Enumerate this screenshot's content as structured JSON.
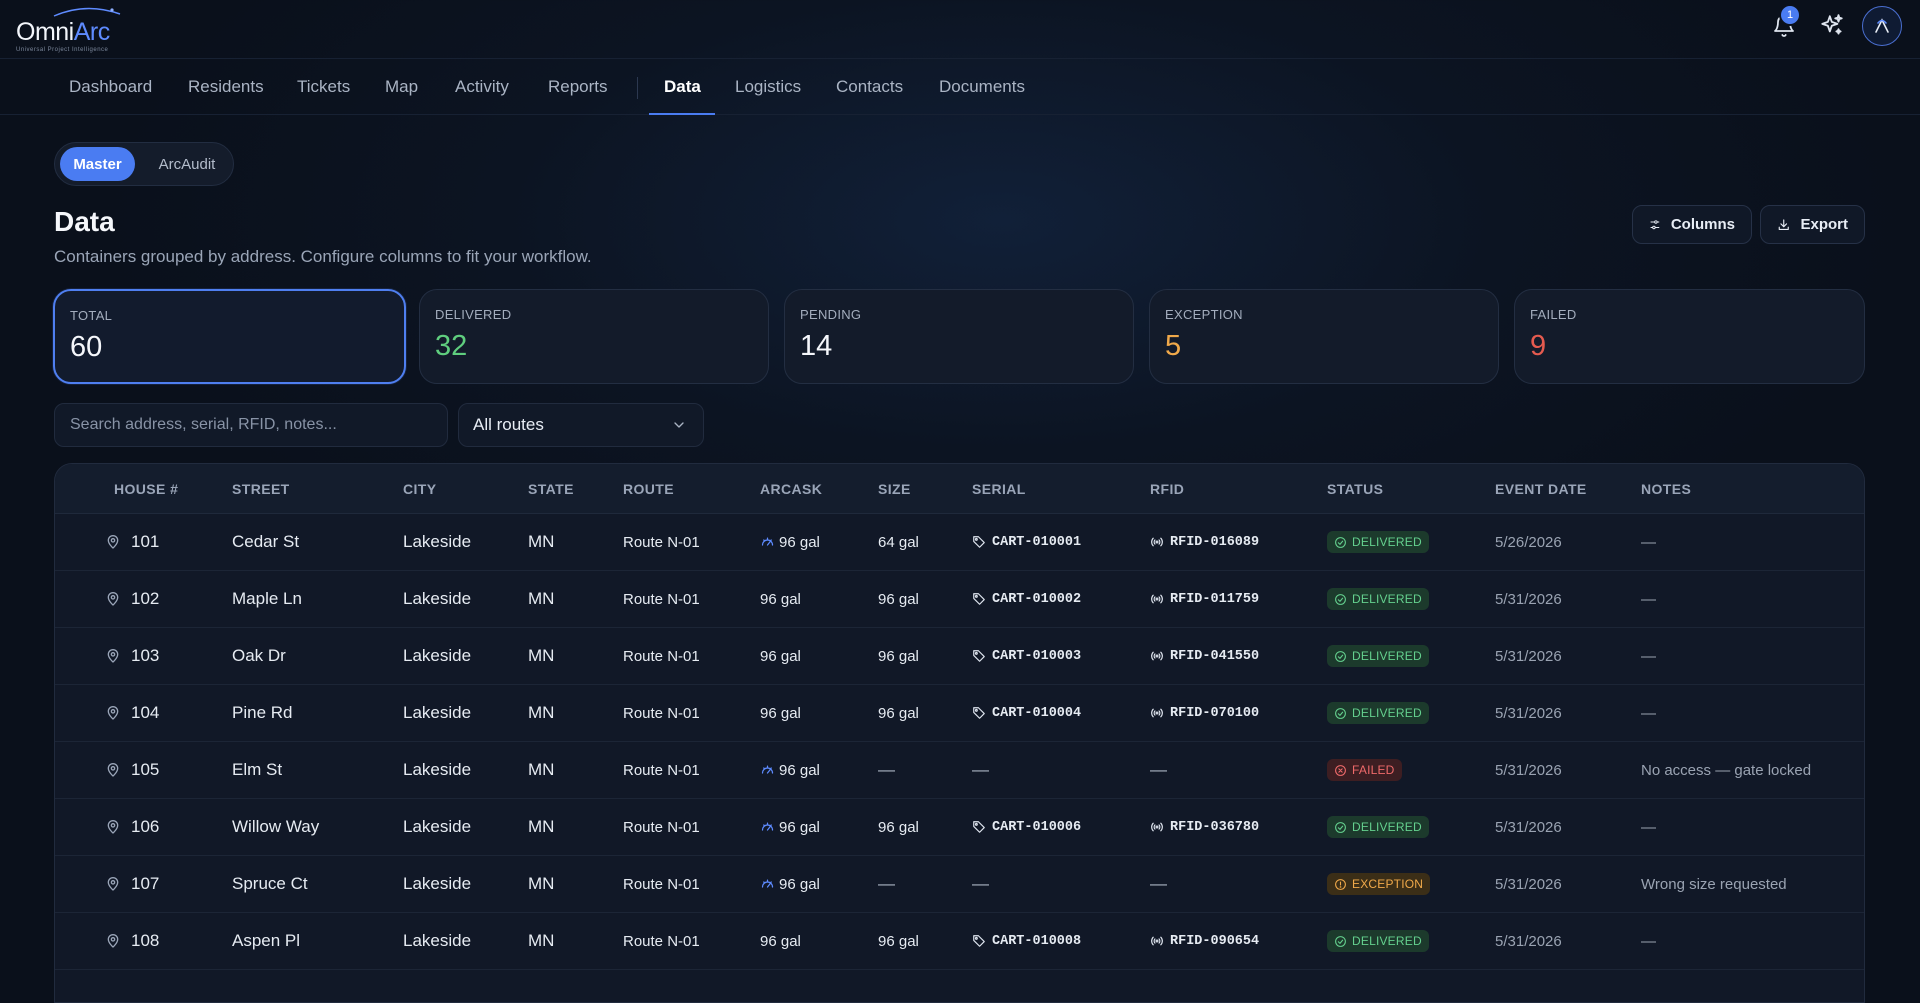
{
  "app": {
    "logo_word_a": "Omni",
    "logo_word_b": "Arc",
    "logo_tagline": "Universal Project Intelligence",
    "notification_count": "1"
  },
  "nav": {
    "items": [
      "Dashboard",
      "Residents",
      "Tickets",
      "Map",
      "Activity",
      "Reports",
      "Data",
      "Logistics",
      "Contacts",
      "Documents"
    ],
    "active": "Data"
  },
  "segment": {
    "on": "Master",
    "off": "ArcAudit"
  },
  "page": {
    "title": "Data",
    "subtitle": "Containers grouped by address. Configure columns to fit your workflow.",
    "columns_label": "Columns",
    "export_label": "Export"
  },
  "stats": [
    {
      "label": "TOTAL",
      "value": "60",
      "color": "#f5f7fb"
    },
    {
      "label": "DELIVERED",
      "value": "32",
      "color": "#5fce7e"
    },
    {
      "label": "PENDING",
      "value": "14",
      "color": "#f5f7fb"
    },
    {
      "label": "EXCEPTION",
      "value": "5",
      "color": "#f0a94a"
    },
    {
      "label": "FAILED",
      "value": "9",
      "color": "#e55b4f"
    }
  ],
  "filters": {
    "search_placeholder": "Search address, serial, RFID, notes...",
    "route_select": "All routes"
  },
  "table": {
    "headers": [
      "HOUSE #",
      "STREET",
      "CITY",
      "STATE",
      "ROUTE",
      "ARCASK",
      "SIZE",
      "SERIAL",
      "RFID",
      "STATUS",
      "EVENT DATE",
      "NOTES"
    ],
    "rows": [
      {
        "house": "101",
        "street": "Cedar St",
        "city": "Lakeside",
        "state": "MN",
        "route": "Route N-01",
        "arcask": "96 gal",
        "arcask_icon": true,
        "size": "64 gal",
        "serial": "CART-010001",
        "rfid": "RFID-016089",
        "status": "DELIVERED",
        "date": "5/26/2026",
        "notes": "—"
      },
      {
        "house": "102",
        "street": "Maple Ln",
        "city": "Lakeside",
        "state": "MN",
        "route": "Route N-01",
        "arcask": "96 gal",
        "arcask_icon": false,
        "size": "96 gal",
        "serial": "CART-010002",
        "rfid": "RFID-011759",
        "status": "DELIVERED",
        "date": "5/31/2026",
        "notes": "—"
      },
      {
        "house": "103",
        "street": "Oak Dr",
        "city": "Lakeside",
        "state": "MN",
        "route": "Route N-01",
        "arcask": "96 gal",
        "arcask_icon": false,
        "size": "96 gal",
        "serial": "CART-010003",
        "rfid": "RFID-041550",
        "status": "DELIVERED",
        "date": "5/31/2026",
        "notes": "—"
      },
      {
        "house": "104",
        "street": "Pine Rd",
        "city": "Lakeside",
        "state": "MN",
        "route": "Route N-01",
        "arcask": "96 gal",
        "arcask_icon": false,
        "size": "96 gal",
        "serial": "CART-010004",
        "rfid": "RFID-070100",
        "status": "DELIVERED",
        "date": "5/31/2026",
        "notes": "—"
      },
      {
        "house": "105",
        "street": "Elm St",
        "city": "Lakeside",
        "state": "MN",
        "route": "Route N-01",
        "arcask": "96 gal",
        "arcask_icon": true,
        "size": "—",
        "serial": "—",
        "rfid": "—",
        "status": "FAILED",
        "date": "5/31/2026",
        "notes": "No access — gate locked"
      },
      {
        "house": "106",
        "street": "Willow Way",
        "city": "Lakeside",
        "state": "MN",
        "route": "Route N-01",
        "arcask": "96 gal",
        "arcask_icon": true,
        "size": "96 gal",
        "serial": "CART-010006",
        "rfid": "RFID-036780",
        "status": "DELIVERED",
        "date": "5/31/2026",
        "notes": "—"
      },
      {
        "house": "107",
        "street": "Spruce Ct",
        "city": "Lakeside",
        "state": "MN",
        "route": "Route N-01",
        "arcask": "96 gal",
        "arcask_icon": true,
        "size": "—",
        "serial": "—",
        "rfid": "—",
        "status": "EXCEPTION",
        "date": "5/31/2026",
        "notes": "Wrong size requested"
      },
      {
        "house": "108",
        "street": "Aspen Pl",
        "city": "Lakeside",
        "state": "MN",
        "route": "Route N-01",
        "arcask": "96 gal",
        "arcask_icon": false,
        "size": "96 gal",
        "serial": "CART-010008",
        "rfid": "RFID-090654",
        "status": "DELIVERED",
        "date": "5/31/2026",
        "notes": "—"
      }
    ]
  },
  "colors": {
    "accent": "#4a7cf2",
    "delivered": "#64d08e",
    "failed": "#ef6a6a",
    "exception": "#f0a94a"
  }
}
